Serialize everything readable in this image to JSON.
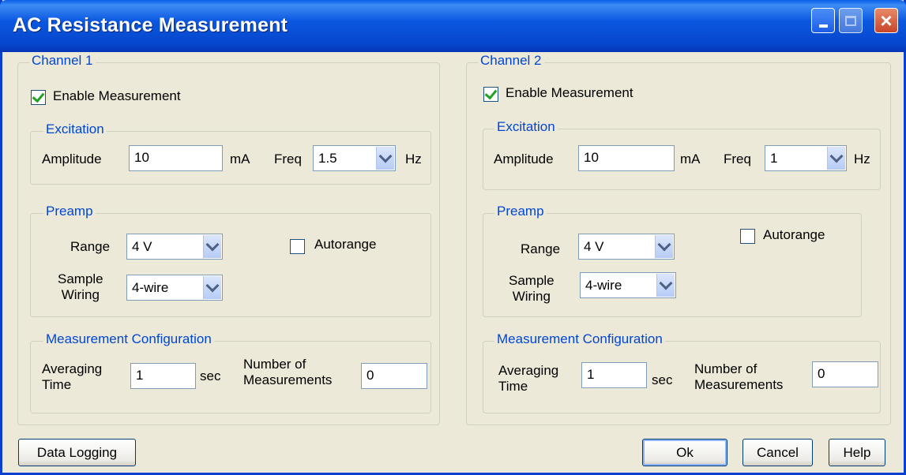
{
  "window": {
    "title": "AC Resistance Measurement"
  },
  "channels": [
    {
      "title": "Channel 1",
      "enable_label": "Enable Measurement",
      "enable_checked": true,
      "excitation": {
        "title": "Excitation",
        "amplitude_label": "Amplitude",
        "amplitude_value": "10",
        "amplitude_unit": "mA",
        "freq_label": "Freq",
        "freq_value": "1.5",
        "freq_unit": "Hz"
      },
      "preamp": {
        "title": "Preamp",
        "range_label": "Range",
        "range_value": "4 V",
        "autorange_label": "Autorange",
        "autorange_checked": false,
        "wiring_label_line1": "Sample",
        "wiring_label_line2": "Wiring",
        "wiring_value": "4-wire"
      },
      "config": {
        "title": "Measurement Configuration",
        "averaging_label_line1": "Averaging",
        "averaging_label_line2": "Time",
        "averaging_value": "1",
        "averaging_unit": "sec",
        "count_label_line1": "Number of",
        "count_label_line2": "Measurements",
        "count_value": "0"
      }
    },
    {
      "title": "Channel 2",
      "enable_label": "Enable Measurement",
      "enable_checked": true,
      "excitation": {
        "title": "Excitation",
        "amplitude_label": "Amplitude",
        "amplitude_value": "10",
        "amplitude_unit": "mA",
        "freq_label": "Freq",
        "freq_value": "1",
        "freq_unit": "Hz"
      },
      "preamp": {
        "title": "Preamp",
        "range_label": "Range",
        "range_value": "4 V",
        "autorange_label": "Autorange",
        "autorange_checked": false,
        "wiring_label_line1": "Sample",
        "wiring_label_line2": "Wiring",
        "wiring_value": "4-wire"
      },
      "config": {
        "title": "Measurement Configuration",
        "averaging_label_line1": "Averaging",
        "averaging_label_line2": "Time",
        "averaging_value": "1",
        "averaging_unit": "sec",
        "count_label_line1": "Number of",
        "count_label_line2": "Measurements",
        "count_value": "0"
      }
    }
  ],
  "footer": {
    "data_logging_label": "Data Logging",
    "ok_label": "Ok",
    "cancel_label": "Cancel",
    "help_label": "Help"
  },
  "colors": {
    "titlebar": "#0a5fe8",
    "dialog_bg": "#ece9d8",
    "group_title": "#0046d5",
    "check": "#21a121"
  }
}
